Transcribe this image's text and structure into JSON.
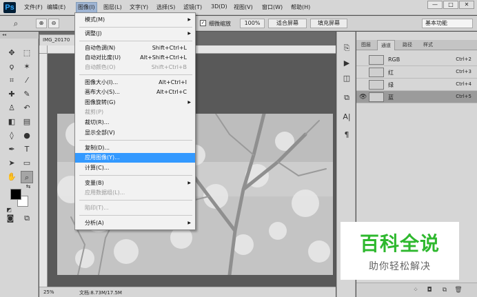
{
  "app": {
    "logo": "Ps"
  },
  "menubar": {
    "items": [
      "文件(F)",
      "编辑(E)",
      "图像(I)",
      "图层(L)",
      "文字(Y)",
      "选择(S)",
      "滤镜(T)",
      "3D(D)",
      "视图(V)",
      "窗口(W)",
      "帮助(H)"
    ],
    "active_index": 2
  },
  "window_controls": {
    "minimize": "—",
    "maximize": "□",
    "close": "✕"
  },
  "options": {
    "zoom_all_windows_label": "细微缩放",
    "zoom_value": "100%",
    "fit_screen": "适合屏幕",
    "fill_screen": "填充屏幕",
    "workspace": "基本功能"
  },
  "document": {
    "tab_title": "IMG_20170",
    "zoom": "25%",
    "doc_size": "文档:8.73M/17.5M"
  },
  "image_menu": {
    "items": [
      {
        "label": "模式(M)",
        "shortcut": "",
        "submenu": true,
        "disabled": false
      },
      {
        "label": "调整(J)",
        "shortcut": "",
        "submenu": true,
        "disabled": false
      },
      {
        "label": "自动色调(N)",
        "shortcut": "Shift+Ctrl+L",
        "submenu": false,
        "disabled": false
      },
      {
        "label": "自动对比度(U)",
        "shortcut": "Alt+Shift+Ctrl+L",
        "submenu": false,
        "disabled": false
      },
      {
        "label": "自动颜色(O)",
        "shortcut": "Shift+Ctrl+B",
        "submenu": false,
        "disabled": true
      },
      {
        "label": "图像大小(I)...",
        "shortcut": "Alt+Ctrl+I",
        "submenu": false,
        "disabled": false
      },
      {
        "label": "画布大小(S)...",
        "shortcut": "Alt+Ctrl+C",
        "submenu": false,
        "disabled": false
      },
      {
        "label": "图像旋转(G)",
        "shortcut": "",
        "submenu": true,
        "disabled": false
      },
      {
        "label": "裁剪(P)",
        "shortcut": "",
        "submenu": false,
        "disabled": true
      },
      {
        "label": "裁切(R)...",
        "shortcut": "",
        "submenu": false,
        "disabled": false
      },
      {
        "label": "显示全部(V)",
        "shortcut": "",
        "submenu": false,
        "disabled": false
      },
      {
        "label": "复制(D)...",
        "shortcut": "",
        "submenu": false,
        "disabled": false
      },
      {
        "label": "应用图像(Y)...",
        "shortcut": "",
        "submenu": false,
        "disabled": false,
        "highlighted": true
      },
      {
        "label": "计算(C)...",
        "shortcut": "",
        "submenu": false,
        "disabled": false
      },
      {
        "label": "变量(B)",
        "shortcut": "",
        "submenu": true,
        "disabled": false
      },
      {
        "label": "应用数据组(L)...",
        "shortcut": "",
        "submenu": false,
        "disabled": true
      },
      {
        "label": "陷印(T)...",
        "shortcut": "",
        "submenu": false,
        "disabled": true
      },
      {
        "label": "分析(A)",
        "shortcut": "",
        "submenu": true,
        "disabled": false
      }
    ]
  },
  "panel": {
    "tabs": [
      "图层",
      "通道",
      "路径",
      "样式"
    ],
    "active_tab": 1,
    "channels": [
      {
        "name": "RGB",
        "shortcut": "Ctrl+2",
        "visible": false,
        "selected": false
      },
      {
        "name": "红",
        "shortcut": "Ctrl+3",
        "visible": false,
        "selected": false
      },
      {
        "name": "绿",
        "shortcut": "Ctrl+4",
        "visible": false,
        "selected": false
      },
      {
        "name": "蓝",
        "shortcut": "Ctrl+5",
        "visible": true,
        "selected": true
      }
    ]
  },
  "watermark": {
    "title": "百科全说",
    "subtitle": "助你轻松解决"
  }
}
